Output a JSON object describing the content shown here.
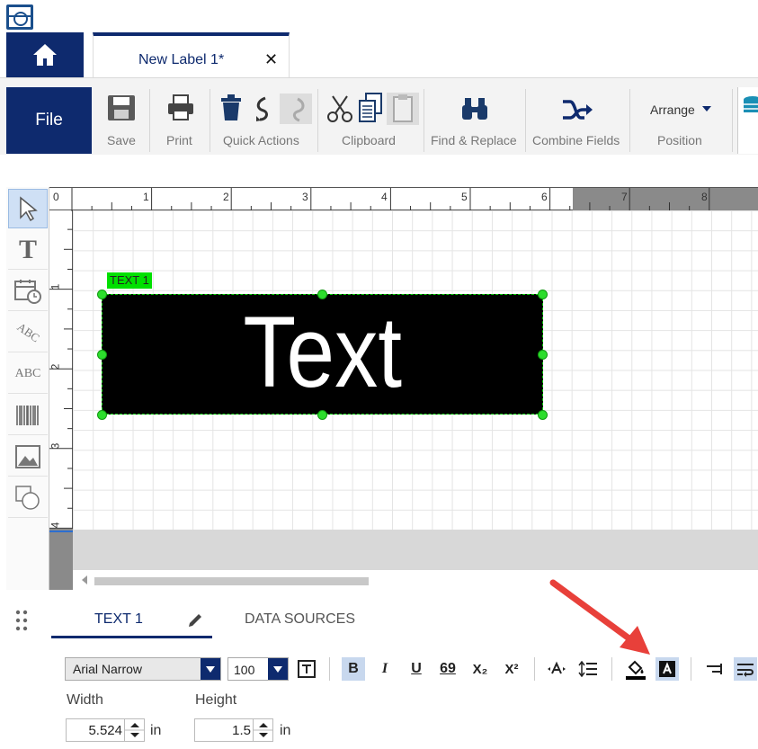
{
  "document_tab": {
    "title": "New Label 1*",
    "close": "✕"
  },
  "ribbon": {
    "file": "File",
    "save": "Save",
    "print": "Print",
    "quick_actions": "Quick Actions",
    "clipboard": "Clipboard",
    "find_replace": "Find & Replace",
    "combine_fields": "Combine Fields",
    "arrange": "Arrange",
    "position": "Position"
  },
  "ruler": {
    "h_ticks": [
      "0",
      "1",
      "2",
      "3",
      "4",
      "5",
      "6",
      "7",
      "8"
    ],
    "v_ticks": [
      "0",
      "1",
      "2",
      "3",
      "4"
    ]
  },
  "canvas": {
    "object_tag": "TEXT 1",
    "object_text": "Text"
  },
  "properties": {
    "tabs": [
      "TEXT 1",
      "DATA SOURCES"
    ],
    "font": "Arial Narrow",
    "font_size": "100",
    "format_buttons": {
      "bold": "B",
      "italic": "I",
      "underline": "U",
      "ligature": "69",
      "subscript": "X₂",
      "superscript": "X²"
    },
    "width_label": "Width",
    "width_value": "5.524",
    "width_unit": "in",
    "height_label": "Height",
    "height_value": "1.5",
    "height_unit": "in"
  },
  "colors": {
    "brand": "#0e2a6e",
    "selection": "#00e000",
    "arrow": "#e8403a"
  }
}
